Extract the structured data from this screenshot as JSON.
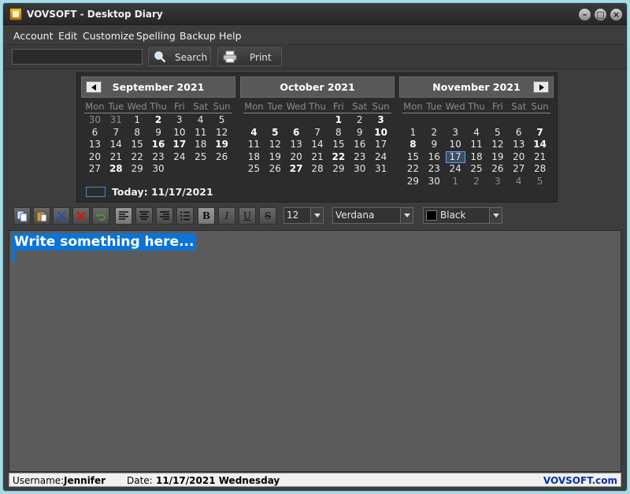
{
  "window": {
    "title": "VOVSOFT - Desktop Diary"
  },
  "menu": [
    "Account",
    "Edit",
    "Customize",
    "Spelling",
    "Backup",
    "Help"
  ],
  "toolbar": {
    "search_value": "",
    "search_label": "Search",
    "print_label": "Print"
  },
  "calendar": {
    "weekdays": [
      "Mon",
      "Tue",
      "Wed",
      "Thu",
      "Fri",
      "Sat",
      "Sun"
    ],
    "months": [
      {
        "title": "September 2021",
        "weeks": [
          [
            [
              "30",
              "o"
            ],
            [
              "31",
              "o"
            ],
            [
              "1",
              ""
            ],
            [
              "2",
              "b"
            ],
            [
              "3",
              ""
            ],
            [
              "4",
              ""
            ],
            [
              "5",
              ""
            ]
          ],
          [
            [
              "6",
              ""
            ],
            [
              "7",
              ""
            ],
            [
              "8",
              ""
            ],
            [
              "9",
              ""
            ],
            [
              "10",
              ""
            ],
            [
              "11",
              ""
            ],
            [
              "12",
              ""
            ]
          ],
          [
            [
              "13",
              ""
            ],
            [
              "14",
              ""
            ],
            [
              "15",
              ""
            ],
            [
              "16",
              "b"
            ],
            [
              "17",
              "b"
            ],
            [
              "18",
              ""
            ],
            [
              "19",
              "b"
            ]
          ],
          [
            [
              "20",
              ""
            ],
            [
              "21",
              ""
            ],
            [
              "22",
              ""
            ],
            [
              "23",
              ""
            ],
            [
              "24",
              ""
            ],
            [
              "25",
              ""
            ],
            [
              "26",
              ""
            ]
          ],
          [
            [
              "27",
              ""
            ],
            [
              "28",
              "b"
            ],
            [
              "29",
              ""
            ],
            [
              "30",
              ""
            ],
            [
              "",
              ""
            ],
            [
              "",
              ""
            ],
            [
              "",
              ""
            ]
          ]
        ]
      },
      {
        "title": "October 2021",
        "weeks": [
          [
            [
              "",
              ""
            ],
            [
              "",
              ""
            ],
            [
              "",
              ""
            ],
            [
              "",
              ""
            ],
            [
              "1",
              "b"
            ],
            [
              "2",
              ""
            ],
            [
              "3",
              "b"
            ]
          ],
          [
            [
              "4",
              "b"
            ],
            [
              "5",
              "b"
            ],
            [
              "6",
              "b"
            ],
            [
              "7",
              ""
            ],
            [
              "8",
              ""
            ],
            [
              "9",
              ""
            ],
            [
              "10",
              "b"
            ]
          ],
          [
            [
              "11",
              ""
            ],
            [
              "12",
              ""
            ],
            [
              "13",
              ""
            ],
            [
              "14",
              ""
            ],
            [
              "15",
              ""
            ],
            [
              "16",
              ""
            ],
            [
              "17",
              ""
            ]
          ],
          [
            [
              "18",
              ""
            ],
            [
              "19",
              ""
            ],
            [
              "20",
              ""
            ],
            [
              "21",
              ""
            ],
            [
              "22",
              "b"
            ],
            [
              "23",
              ""
            ],
            [
              "24",
              ""
            ]
          ],
          [
            [
              "25",
              ""
            ],
            [
              "26",
              ""
            ],
            [
              "27",
              "b"
            ],
            [
              "28",
              ""
            ],
            [
              "29",
              ""
            ],
            [
              "30",
              ""
            ],
            [
              "31",
              ""
            ]
          ]
        ]
      },
      {
        "title": "November 2021",
        "weeks": [
          [
            [
              "",
              ""
            ],
            [
              "",
              ""
            ],
            [
              "",
              ""
            ],
            [
              "",
              ""
            ],
            [
              "",
              ""
            ],
            [
              "",
              ""
            ],
            [
              "",
              ""
            ]
          ],
          [
            [
              "1",
              ""
            ],
            [
              "2",
              ""
            ],
            [
              "3",
              ""
            ],
            [
              "4",
              ""
            ],
            [
              "5",
              ""
            ],
            [
              "6",
              ""
            ],
            [
              "7",
              "b"
            ]
          ],
          [
            [
              "8",
              "b"
            ],
            [
              "9",
              ""
            ],
            [
              "10",
              ""
            ],
            [
              "11",
              ""
            ],
            [
              "12",
              ""
            ],
            [
              "13",
              ""
            ],
            [
              "14",
              "b"
            ]
          ],
          [
            [
              "15",
              ""
            ],
            [
              "16",
              ""
            ],
            [
              "17",
              "t"
            ],
            [
              "18",
              ""
            ],
            [
              "19",
              ""
            ],
            [
              "20",
              ""
            ],
            [
              "21",
              ""
            ]
          ],
          [
            [
              "22",
              ""
            ],
            [
              "23",
              ""
            ],
            [
              "24",
              ""
            ],
            [
              "25",
              ""
            ],
            [
              "26",
              ""
            ],
            [
              "27",
              ""
            ],
            [
              "28",
              ""
            ]
          ],
          [
            [
              "29",
              ""
            ],
            [
              "30",
              ""
            ],
            [
              "1",
              "o"
            ],
            [
              "2",
              "o"
            ],
            [
              "3",
              "o"
            ],
            [
              "4",
              "o"
            ],
            [
              "5",
              "o"
            ]
          ]
        ]
      }
    ],
    "today_label": "Today: 11/17/2021"
  },
  "format": {
    "font_size": "12",
    "font_name": "Verdana",
    "color_name": "Black",
    "color_swatch": "#000000",
    "bold_label": "B",
    "italic_label": "I",
    "underline_label": "U",
    "strike_label": "S"
  },
  "editor": {
    "text": "Write something here..."
  },
  "status": {
    "username_label": "Username:",
    "username": "Jennifer",
    "date_label": "Date:",
    "date": "11/17/2021 Wednesday",
    "brand": "VOVSOFT.com"
  }
}
